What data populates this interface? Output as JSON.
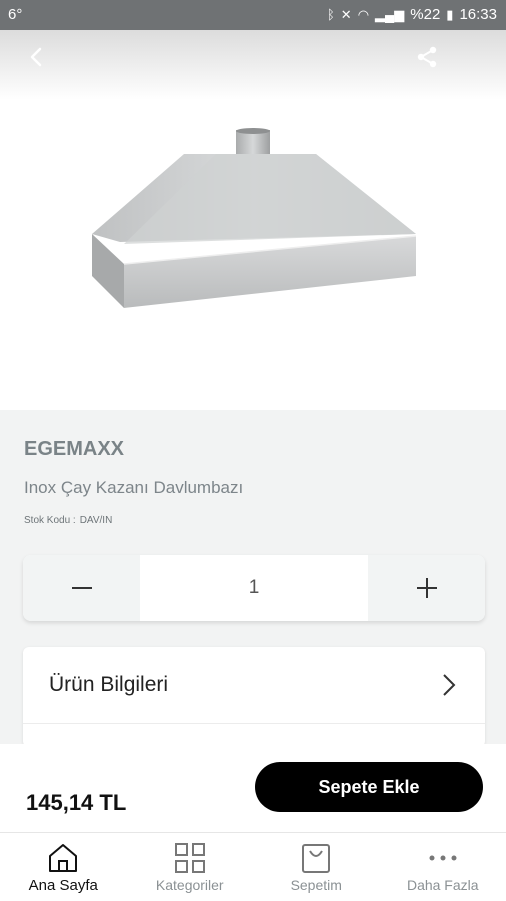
{
  "status_bar": {
    "temperature": "6°",
    "battery_text": "%22",
    "time": "16:33"
  },
  "product": {
    "brand": "EGEMAXX",
    "name": "Inox Çay Kazanı Davlumbazı",
    "stock_label": "Stok Kodu :",
    "stock_code": "DAV/IN",
    "quantity": "1",
    "price": "145,14 TL"
  },
  "info": {
    "product_info_label": "Ürün Bilgileri"
  },
  "actions": {
    "add_to_cart": "Sepete Ekle"
  },
  "tabs": [
    {
      "label": "Ana Sayfa",
      "icon": "home-icon",
      "active": true
    },
    {
      "label": "Kategoriler",
      "icon": "grid-icon",
      "active": false
    },
    {
      "label": "Sepetim",
      "icon": "bag-icon",
      "active": false
    },
    {
      "label": "Daha Fazla",
      "icon": "more-icon",
      "active": false
    }
  ],
  "colors": {
    "status_bar": "#6f7274",
    "accent_button": "#000000",
    "brand_text": "#7a8387"
  }
}
